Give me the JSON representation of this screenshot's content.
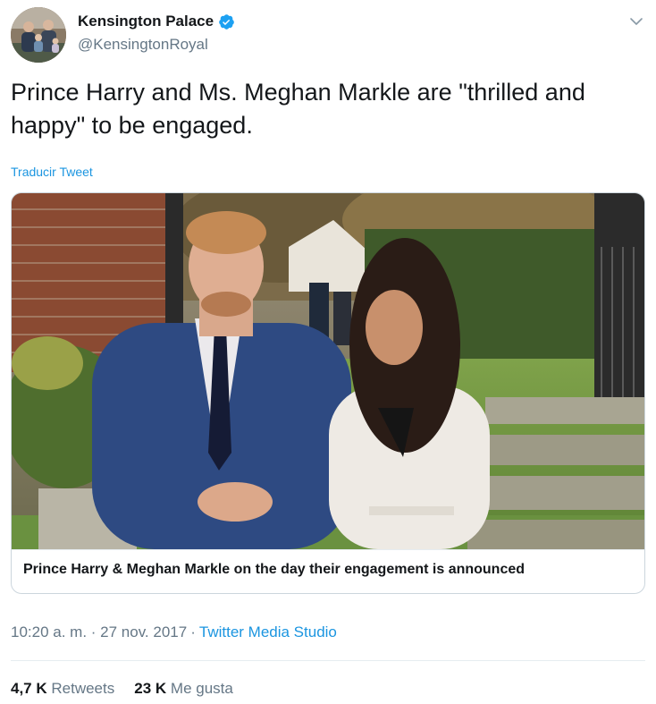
{
  "tweet": {
    "author": {
      "display_name": "Kensington Palace",
      "handle": "@KensingtonRoyal",
      "verified": true
    },
    "text": "Prince Harry and Ms. Meghan Markle are \"thrilled and happy\" to be engaged.",
    "translate_label": "Traducir Tweet",
    "card": {
      "caption": "Prince Harry & Meghan Markle on the day their engagement is announced"
    },
    "timestamp": "10:20 a. m. · 27 nov. 2017",
    "separator": "·",
    "source": "Twitter Media Studio",
    "stats": {
      "retweets_count": "4,7 K",
      "retweets_label": "Retweets",
      "likes_count": "23 K",
      "likes_label": "Me gusta"
    }
  },
  "icons": {
    "verified": "verified-badge-icon",
    "menu": "chevron-down-icon"
  },
  "colors": {
    "text_primary": "#14171a",
    "text_secondary": "#657786",
    "link": "#1b95e0",
    "verified": "#1da1f2",
    "border": "#ccd6dd"
  }
}
